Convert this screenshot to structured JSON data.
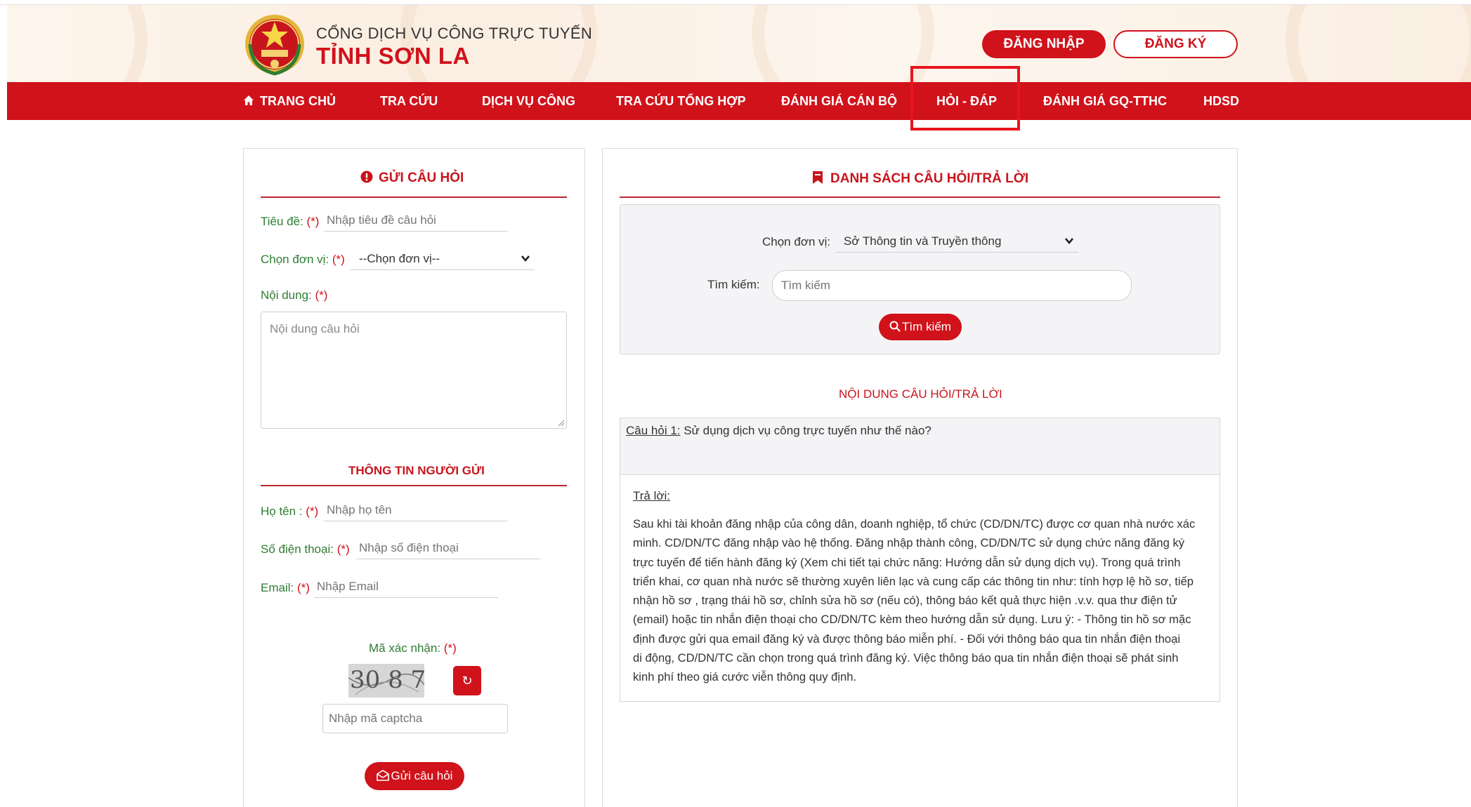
{
  "header": {
    "brand_top": "CỔNG DỊCH VỤ CÔNG TRỰC TUYẾN",
    "brand_main": "TỈNH SƠN LA",
    "login_label": "ĐĂNG NHẬP",
    "register_label": "ĐĂNG KÝ"
  },
  "nav": {
    "items": [
      {
        "label": "TRANG CHỦ",
        "icon": "home-icon"
      },
      {
        "label": "TRA CỨU"
      },
      {
        "label": "DỊCH VỤ CÔNG"
      },
      {
        "label": "TRA CỨU TỔNG HỢP"
      },
      {
        "label": "ĐÁNH GIÁ CÁN BỘ"
      },
      {
        "label": "HỎI - ĐÁP",
        "active": true
      },
      {
        "label": "ĐÁNH GIÁ GQ-TTHC"
      },
      {
        "label": "HDSD"
      }
    ]
  },
  "ask_form": {
    "title": "GỬI CÂU HỎI",
    "title_icon": "info-circle-icon",
    "subject_label": "Tiêu đề:",
    "subject_placeholder": "Nhập tiêu đề câu hỏi",
    "unit_label": "Chọn đơn vị:",
    "unit_value": "--Chọn đơn vị--",
    "content_label": "Nội dung:",
    "content_placeholder": "Nội dung câu hỏi",
    "required_mark": "(*)",
    "sender_title": "THÔNG TIN NGƯỜI GỬI",
    "name_label": "Họ tên :",
    "name_placeholder": "Nhập họ tên",
    "phone_label": "Số điện thoại:",
    "phone_placeholder": "Nhập số điện thoại",
    "email_label": "Email:",
    "email_placeholder": "Nhập Email",
    "captcha_label": "Mã xác nhận:",
    "captcha_text": "30 8 7",
    "refresh_icon": "refresh-icon",
    "captcha_placeholder": "Nhập mã captcha",
    "submit_label": "Gửi câu hỏi",
    "submit_icon": "envelope-icon"
  },
  "qa_list": {
    "title": "DANH SÁCH CÂU HỎI/TRẢ LỜI",
    "title_icon": "bookmark-icon",
    "unit_label": "Chọn đơn vị:",
    "unit_value": "Sở Thông tin và Truyền thông",
    "search_label": "Tìm kiếm:",
    "search_placeholder": "Tìm kiếm",
    "search_button": "Tìm kiếm",
    "search_icon": "search-icon",
    "content_title": "NỘI DUNG CÂU HỎI/TRẢ LỜI",
    "question_prefix": "Câu hỏi 1:",
    "question_text": " Sử dụng dịch vụ công trực tuyến như thế nào?",
    "answer_label": "Trả lời:",
    "answer_lines": [
      "Sau khi tài khoản đăng nhập của công dân, doanh nghiệp, tổ chức (CD/DN/TC) được cơ quan nhà nước xác",
      "minh. CD/DN/TC đăng nhập vào hệ thống. Đăng nhập thành công, CD/DN/TC sử dụng chức năng đăng ký",
      "trực tuyến để tiến hành đăng ký (Xem chi tiết tại chức năng: Hướng dẫn sử dụng dịch vụ). Trong quá trình",
      "triển khai, cơ quan nhà nước sẽ thường xuyên liên lạc và cung cấp các thông tin như: tính hợp lệ hồ sơ, tiếp",
      "nhận hồ sơ , trạng thái hồ sơ, chỉnh sửa hồ sơ (nếu có), thông báo kết quả thực hiện .v.v. qua thư điện tử",
      "(email) hoặc tin nhắn điện thoại cho CD/DN/TC kèm theo hướng dẫn sử dụng. Lưu ý: - Thông tin hồ sơ mặc",
      "định được gửi qua email đăng ký và được thông báo miễn phí. - Đối với thông báo qua tin nhắn điện thoại",
      "di động, CD/DN/TC cần chọn trong quá trình đăng ký. Việc thông báo qua tin nhắn điện thoại sẽ phát sinh",
      "kinh phí theo giá cước viễn thông quy định."
    ]
  },
  "colors": {
    "primary_red": "#d0121b",
    "label_green": "#2e7d32"
  }
}
